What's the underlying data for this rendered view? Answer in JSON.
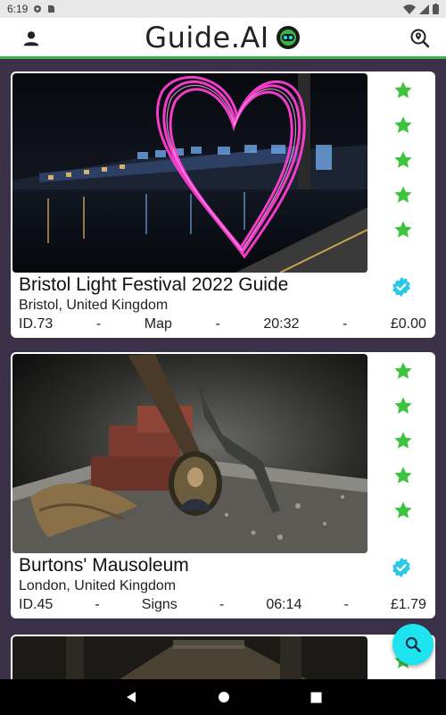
{
  "status_bar": {
    "time": "6:19"
  },
  "app_bar": {
    "title": "Guide.AI",
    "profile_icon": "person-icon",
    "search_location_icon": "location-search-icon"
  },
  "cards": [
    {
      "title": "Bristol Light Festival 2022 Guide",
      "location": "Bristol, United Kingdom",
      "id": "ID.73",
      "sep1": "-",
      "type": "Map",
      "sep2": "-",
      "duration": "20:32",
      "sep3": "-",
      "price": "£0.00",
      "rating": 5,
      "verified": true
    },
    {
      "title": "Burtons' Mausoleum",
      "location": "London, United Kingdom",
      "id": "ID.45",
      "sep1": "-",
      "type": "Signs",
      "sep2": "-",
      "duration": "06:14",
      "sep3": "-",
      "price": "£1.79",
      "rating": 5,
      "verified": true
    }
  ],
  "colors": {
    "accent": "#3bb34a",
    "star": "#3cc43c",
    "verified": "#28c8e6",
    "fab": "#1de4ee",
    "background": "#3b3249"
  },
  "fab_icon": "search-icon",
  "nav": {
    "back_icon": "back-icon",
    "home_icon": "home-icon",
    "recents_icon": "recents-icon"
  }
}
